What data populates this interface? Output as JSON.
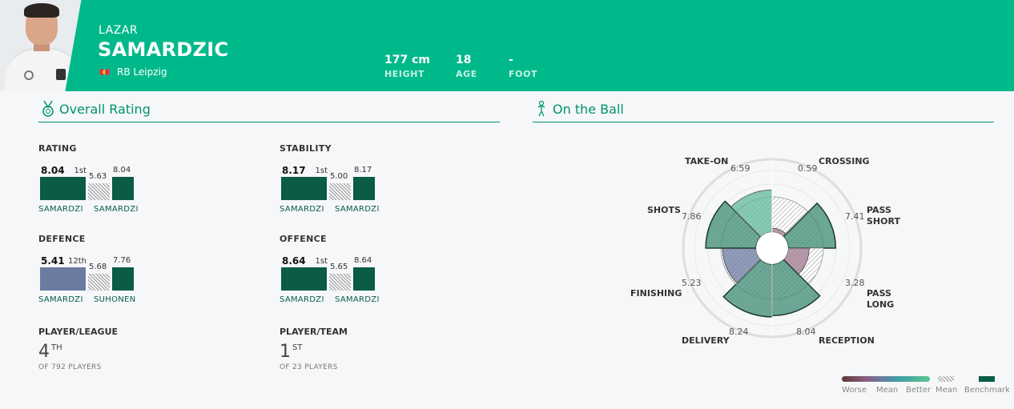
{
  "player": {
    "first_name": "LAZAR",
    "last_name": "SAMARDZIC",
    "club": "RB Leipzig",
    "stats": [
      {
        "value": "177 cm",
        "label": "HEIGHT"
      },
      {
        "value": "18",
        "label": "AGE"
      },
      {
        "value": "-",
        "label": "FOOT"
      }
    ]
  },
  "sections": {
    "overall": "Overall Rating",
    "on_ball": "On the Ball"
  },
  "ratings": [
    {
      "label": "RATING",
      "value": "8.04",
      "rank": "1st",
      "mean": "5.63",
      "bench": "8.04",
      "name": "SAMARDZI",
      "bench_name": "SAMARDZI",
      "color": "#0a5c47"
    },
    {
      "label": "STABILITY",
      "value": "8.17",
      "rank": "1st",
      "mean": "5.00",
      "bench": "8.17",
      "name": "SAMARDZI",
      "bench_name": "SAMARDZI",
      "color": "#0a5c47"
    },
    {
      "label": "DEFENCE",
      "value": "5.41",
      "rank": "12th",
      "mean": "5.68",
      "bench": "7.76",
      "name": "SAMARDZI",
      "bench_name": "SUHONEN",
      "color": "#6b7ba1"
    },
    {
      "label": "OFFENCE",
      "value": "8.64",
      "rank": "1st",
      "mean": "5.65",
      "bench": "8.64",
      "name": "SAMARDZI",
      "bench_name": "SAMARDZI",
      "color": "#0a5c47"
    }
  ],
  "rankings": [
    {
      "label": "PLAYER/LEAGUE",
      "value": "4",
      "suffix": "TH",
      "sub": "OF 792 PLAYERS"
    },
    {
      "label": "PLAYER/TEAM",
      "value": "1",
      "suffix": "ST",
      "sub": "OF 23 PLAYERS"
    }
  ],
  "radar": {
    "categories": [
      {
        "name": "CROSSING",
        "value": "0.59"
      },
      {
        "name": "PASS SHORT",
        "value": "7.41"
      },
      {
        "name": "PASS LONG",
        "value": "3.28"
      },
      {
        "name": "RECEPTION",
        "value": "8.04"
      },
      {
        "name": "DELIVERY",
        "value": "8.24"
      },
      {
        "name": "FINISHING",
        "value": "5.23"
      },
      {
        "name": "SHOTS",
        "value": "7.86"
      },
      {
        "name": "TAKE-ON",
        "value": "6.59"
      }
    ]
  },
  "legend": {
    "worse": "Worse",
    "mean": "Mean",
    "better": "Better",
    "mean2": "Mean",
    "benchmark": "Benchmark"
  }
}
